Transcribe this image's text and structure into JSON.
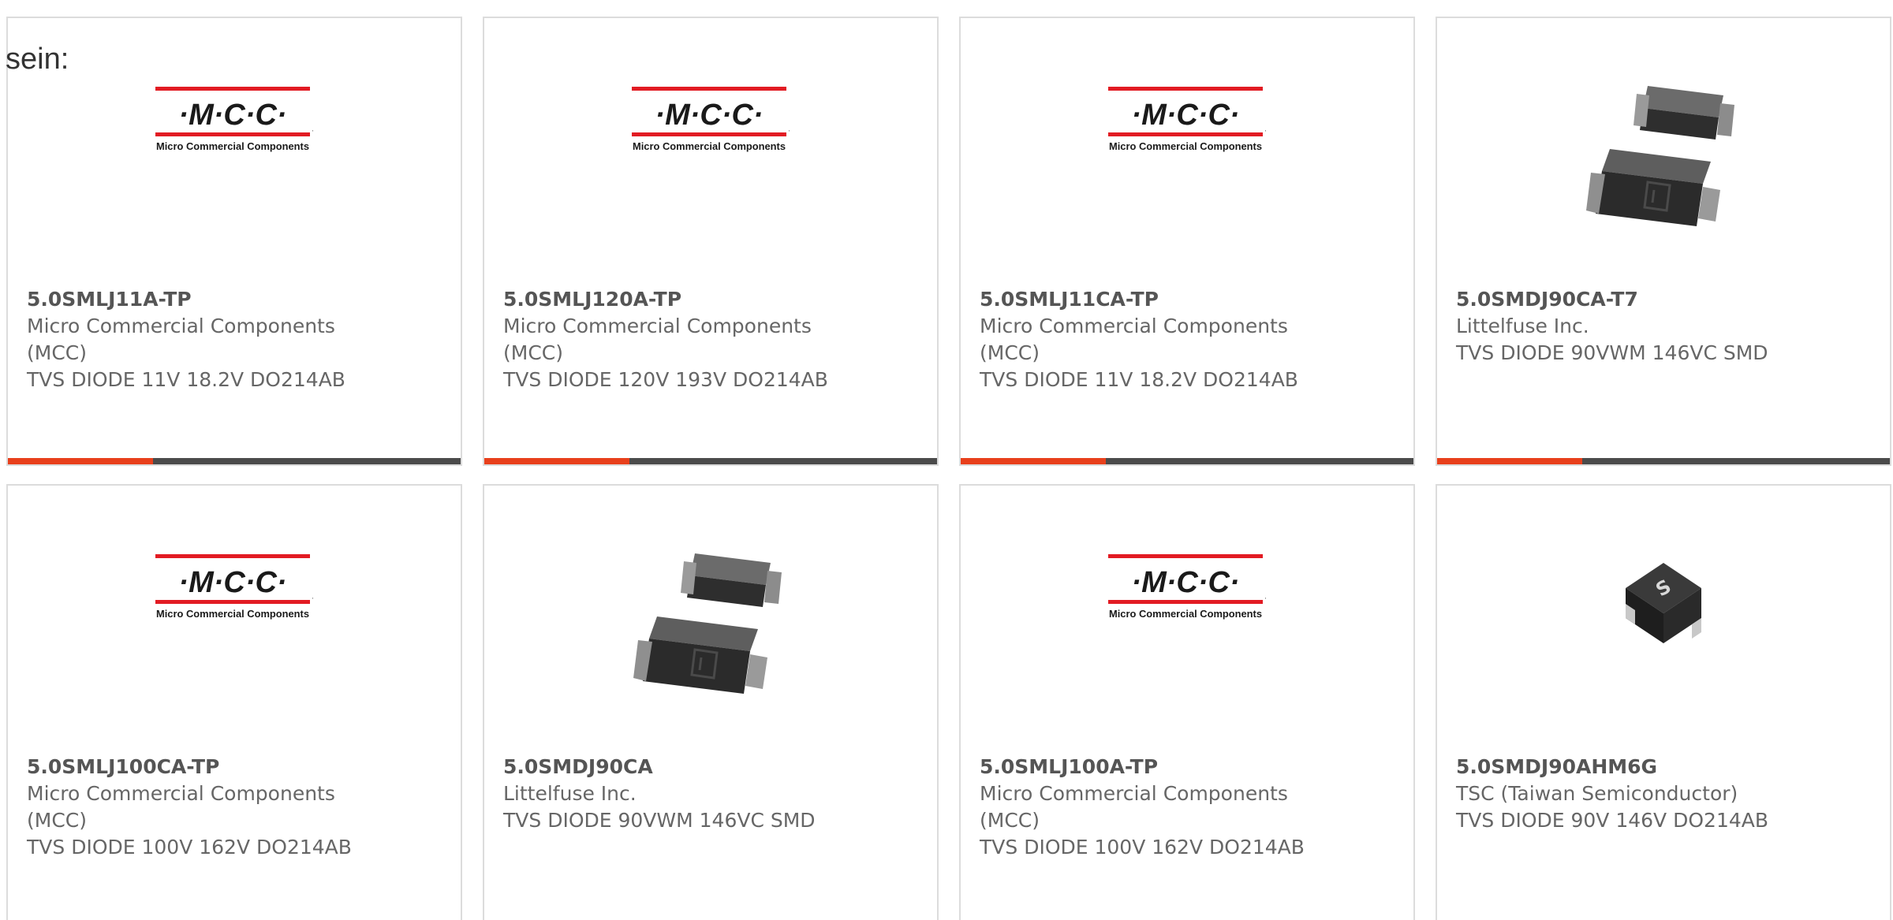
{
  "intro_text": "sein:",
  "colors": {
    "accent": "#e8401c",
    "bar": "#4b4b4b",
    "mcc_red": "#e21b23",
    "mcc_text": "#1a1a1a",
    "border": "#dcdcdc"
  },
  "products": [
    {
      "part": "5.0SMLJ11A-TP",
      "mfr1": "Micro Commercial Components",
      "mfr2": "(MCC)",
      "desc": "TVS DIODE 11V 18.2V DO214AB",
      "image": "mcc-logo"
    },
    {
      "part": "5.0SMLJ120A-TP",
      "mfr1": "Micro Commercial Components",
      "mfr2": "(MCC)",
      "desc": "TVS DIODE 120V 193V DO214AB",
      "image": "mcc-logo"
    },
    {
      "part": "5.0SMLJ11CA-TP",
      "mfr1": "Micro Commercial Components",
      "mfr2": "(MCC)",
      "desc": "TVS DIODE 11V 18.2V DO214AB",
      "image": "mcc-logo"
    },
    {
      "part": "5.0SMDJ90CA-T7",
      "mfr1": "Littelfuse Inc.",
      "mfr2": "",
      "desc": "TVS DIODE 90VWM 146VC SMD",
      "image": "smd-package"
    },
    {
      "part": "5.0SMLJ100CA-TP",
      "mfr1": "Micro Commercial Components",
      "mfr2": "(MCC)",
      "desc": "TVS DIODE 100V 162V DO214AB",
      "image": "mcc-logo"
    },
    {
      "part": "5.0SMDJ90CA",
      "mfr1": "Littelfuse Inc.",
      "mfr2": "",
      "desc": "TVS DIODE 90VWM 146VC SMD",
      "image": "smd-package"
    },
    {
      "part": "5.0SMLJ100A-TP",
      "mfr1": "Micro Commercial Components",
      "mfr2": "(MCC)",
      "desc": "TVS DIODE 100V 162V DO214AB",
      "image": "mcc-logo"
    },
    {
      "part": "5.0SMDJ90AHM6G",
      "mfr1": "TSC (Taiwan Semiconductor)",
      "mfr2": "",
      "desc": "TVS DIODE 90V 146V DO214AB",
      "image": "tsc-chip"
    }
  ],
  "mcc_logo": {
    "letters": "·M·C·C·",
    "subtitle": "Micro Commercial Components",
    "tm": "™"
  }
}
